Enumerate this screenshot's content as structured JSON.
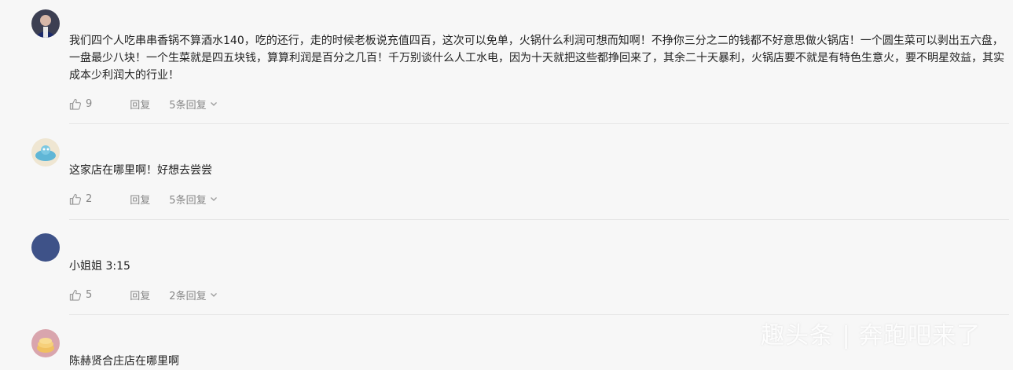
{
  "comments": [
    {
      "username": "",
      "text": "我们四个人吃串串香锅不算酒水140，吃的还行，走的时候老板说充值四百，这次可以免单，火锅什么利润可想而知啊！不挣你三分之二的钱都不好意思做火锅店！一个圆生菜可以剥出五六盘，一盘最少八块！一个生菜就是四五块钱，算算利润是百分之几百！千万别谈什么人工水电，因为十天就把这些都挣回来了，其余二十天暴利，火锅店要不就是有特色生意火，要不明星效益，其实成本少利润大的行业！",
      "likes": "9",
      "reply_label": "回复",
      "replies_label": "5条回复"
    },
    {
      "username": "",
      "text": "这家店在哪里啊！好想去尝尝",
      "likes": "2",
      "reply_label": "回复",
      "replies_label": "5条回复"
    },
    {
      "username": "",
      "text": "小姐姐 3:15",
      "likes": "5",
      "reply_label": "回复",
      "replies_label": "2条回复"
    },
    {
      "username": "",
      "text": "陈赫贤合庄店在哪里啊"
    }
  ],
  "watermark": "趣头条 | 奔跑吧来了",
  "icons": {
    "like": "thumbs-up-icon",
    "expand": "chevron-down-icon"
  },
  "colors": {
    "background": "#f7f7f7",
    "meta_text": "#888888",
    "divider": "#e6e6e6"
  }
}
